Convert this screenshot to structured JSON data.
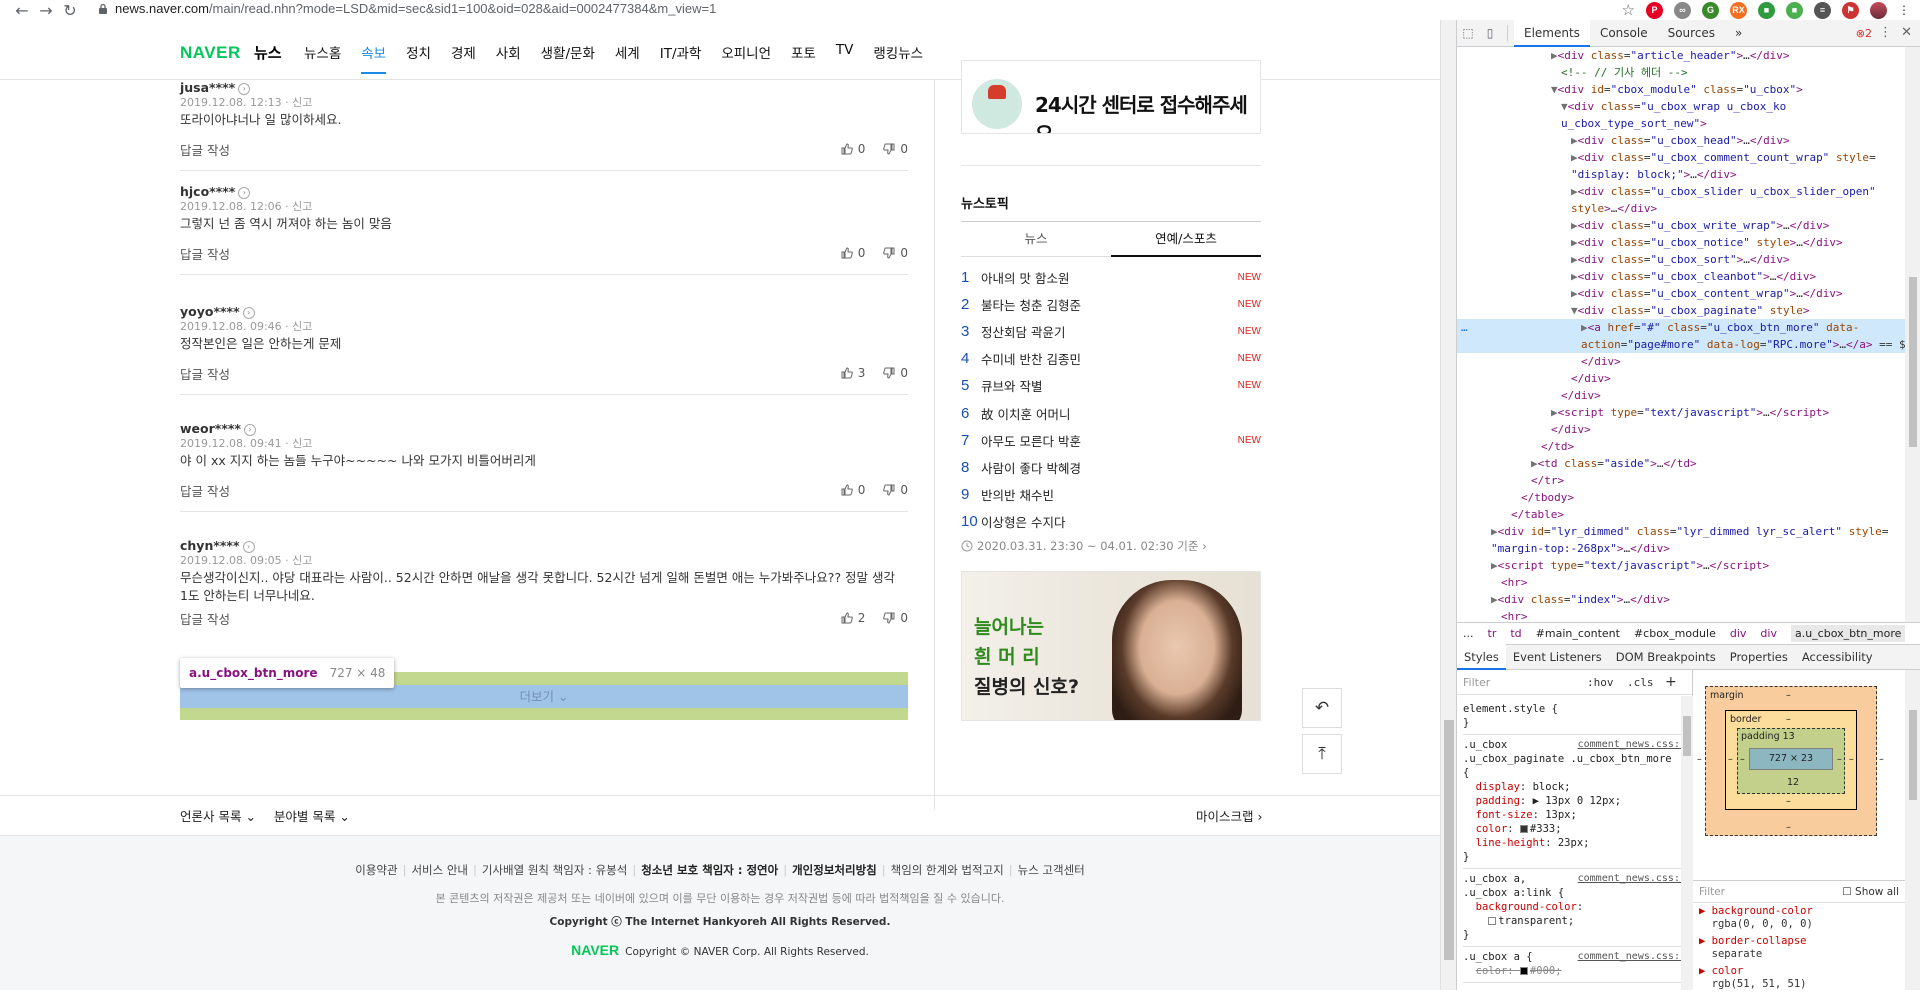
{
  "browser": {
    "url_host": "news.naver.com",
    "url_rest": "/main/read.nhn?mode=LSD&mid=sec&sid1=100&oid=028&aid=0002477384&m_view=1",
    "extensions": [
      {
        "name": "pinterest-icon",
        "color": "#e60023",
        "label": "P"
      },
      {
        "name": "ext-link-icon",
        "color": "#888888",
        "label": "∞"
      },
      {
        "name": "ext-green-icon",
        "color": "#3c8a2e",
        "label": "G"
      },
      {
        "name": "ext-rx-icon",
        "color": "#f36f20",
        "label": "RX"
      },
      {
        "name": "ext-green2-icon",
        "color": "#2e9b3e",
        "label": "■"
      },
      {
        "name": "ext-green3-icon",
        "color": "#4caf50",
        "label": "■"
      },
      {
        "name": "ext-queue-icon",
        "color": "#555555",
        "label": "≡"
      },
      {
        "name": "ext-flag-icon",
        "color": "#cc3333",
        "label": "⚑"
      }
    ]
  },
  "gnb": {
    "logo": "NAVER",
    "logo_sub": "뉴스",
    "menu": [
      "뉴스홈",
      "속보",
      "정치",
      "경제",
      "사회",
      "생활/문화",
      "세계",
      "IT/과학",
      "오피니언",
      "포토",
      "TV",
      "랭킹뉴스"
    ],
    "active_index": 1
  },
  "comments": [
    {
      "user": "jusa****",
      "date": "2019.12.08. 12:13 · 신고",
      "text": "또라이아냐너나 일 많이하세요.",
      "reply": "답글 작성",
      "up": "0",
      "down": "0"
    },
    {
      "user": "hjco****",
      "date": "2019.12.08. 12:06 · 신고",
      "text": "그렇지 넌 좀 역시 꺼져야 하는 놈이 맞음",
      "reply": "답글 작성",
      "up": "0",
      "down": "0"
    },
    {
      "user": "yoyo****",
      "date": "2019.12.08. 09:46 · 신고",
      "text": "정작본인은 일은 안하는게 문제",
      "reply": "답글 작성",
      "up": "3",
      "down": "0"
    },
    {
      "user": "weor****",
      "date": "2019.12.08. 09:41 · 신고",
      "text": "야 이 xx 지지 하는 놈들 누구야~~~~~ 나와 모가지 비틀어버리게",
      "reply": "답글 작성",
      "up": "0",
      "down": "0"
    },
    {
      "user": "chyn****",
      "date": "2019.12.08. 09:05 · 신고",
      "text": "무슨생각이신지.. 야당 대표라는 사람이.. 52시간 안하면 애날을 생각 못합니다. 52시간 넘게 일해 돈벌면 애는 누가봐주나요?? 정말 생각 1도 안하는티 너무나네요.",
      "reply": "답글 작성",
      "up": "2",
      "down": "0"
    }
  ],
  "tooltip": {
    "selector": "a.u_cbox_btn_more",
    "size": "727 × 48"
  },
  "more_button": "더보기 ⌄",
  "aside": {
    "banner_top_text": "24시간 센터로 접수해주세요",
    "topic_title": "뉴스토픽",
    "tabs": [
      "뉴스",
      "연예/스포츠"
    ],
    "active_tab": 1,
    "ranks": [
      {
        "num": "1",
        "title": "아내의 맛 함소원",
        "badge": "NEW"
      },
      {
        "num": "2",
        "title": "불타는 청춘 김형준",
        "badge": "NEW"
      },
      {
        "num": "3",
        "title": "정산회담 곽윤기",
        "badge": "NEW"
      },
      {
        "num": "4",
        "title": "수미네 반찬 김종민",
        "badge": "NEW"
      },
      {
        "num": "5",
        "title": "큐브와 작별",
        "badge": "NEW"
      },
      {
        "num": "6",
        "title": "故 이치훈 어머니",
        "badge": ""
      },
      {
        "num": "7",
        "title": "아무도 모른다 박훈",
        "badge": "NEW"
      },
      {
        "num": "8",
        "title": "사람이 좋다 박혜경",
        "badge": ""
      },
      {
        "num": "9",
        "title": "반의반 채수빈",
        "badge": ""
      },
      {
        "num": "10",
        "title": "이상형은 수지다",
        "badge": ""
      }
    ],
    "rank_time": "2020.03.31. 23:30 ~ 04.01. 02:30 기준 ›",
    "ad_lines": [
      "늘어나는",
      "흰 머 리",
      "질병의 신호?"
    ]
  },
  "float_buttons": {
    "back": "↶",
    "top": "⤒"
  },
  "footer_nav": {
    "left": [
      "언론사 목록 ⌄",
      "분야별 목록 ⌄"
    ],
    "right": "마이스크랩 ›"
  },
  "footer": {
    "links": [
      "이용약관",
      "서비스 안내",
      "기사배열 원칙 책임자 : 유봉석",
      "청소년 보호 책임자 : 정연아",
      "개인정보처리방침",
      "책임의 한계와 법적고지",
      "뉴스 고객센터"
    ],
    "bold_links": [
      3,
      4
    ],
    "note": "본 콘텐츠의 저작권은 제공처 또는 네이버에 있으며 이를 무단 이용하는 경우 저작권법 등에 따라 법적책임을 질 수 있습니다.",
    "copy1": "Copyright ⓒ The Internet Hankyoreh All Rights Reserved.",
    "copy2_logo": "NAVER",
    "copy2": "Copyright © NAVER Corp. All Rights Reserved."
  },
  "devtools": {
    "tabs": [
      "Elements",
      "Console",
      "Sources",
      "»"
    ],
    "active_tab": 0,
    "errors": "⊗2",
    "dom_lines": [
      {
        "indent": 10,
        "html": "<span class='tri'>▶</span><span class='tag'>&lt;div</span> <span class='attr'>class</span>=<span class='val'>\"article_header\"</span><span class='tag'>&gt;</span>…<span class='tag'>&lt;/div&gt;</span>"
      },
      {
        "indent": 11,
        "html": "<span class='cmt'>&lt;!-- // 기사 헤더 --&gt;</span>"
      },
      {
        "indent": 10,
        "html": "<span class='tri'>▼</span><span class='tag'>&lt;div</span> <span class='attr'>id</span>=<span class='val'>\"cbox_module\"</span> <span class='attr'>class</span>=<span class='val'>\"u_cbox\"</span><span class='tag'>&gt;</span>"
      },
      {
        "indent": 11,
        "html": "<span class='tri'>▼</span><span class='tag'>&lt;div</span> <span class='attr'>class</span>=<span class='val'>\"u_cbox_wrap u_cbox_ko</span>"
      },
      {
        "indent": 11,
        "html": "<span class='val'>u_cbox_type_sort_new\"</span><span class='tag'>&gt;</span>"
      },
      {
        "indent": 12,
        "html": "<span class='tri'>▶</span><span class='tag'>&lt;div</span> <span class='attr'>class</span>=<span class='val'>\"u_cbox_head\"</span><span class='tag'>&gt;</span>…<span class='tag'>&lt;/div&gt;</span>"
      },
      {
        "indent": 12,
        "html": "<span class='tri'>▶</span><span class='tag'>&lt;div</span> <span class='attr'>class</span>=<span class='val'>\"u_cbox_comment_count_wrap\"</span> <span class='attr'>style</span>="
      },
      {
        "indent": 12,
        "html": "<span class='val'>\"display: block;\"</span><span class='tag'>&gt;</span>…<span class='tag'>&lt;/div&gt;</span>"
      },
      {
        "indent": 12,
        "html": "<span class='tri'>▶</span><span class='tag'>&lt;div</span> <span class='attr'>class</span>=<span class='val'>\"u_cbox_slider u_cbox_slider_open\"</span>"
      },
      {
        "indent": 12,
        "html": "<span class='attr'>style</span><span class='tag'>&gt;</span>…<span class='tag'>&lt;/div&gt;</span>"
      },
      {
        "indent": 12,
        "html": "<span class='tri'>▶</span><span class='tag'>&lt;div</span> <span class='attr'>class</span>=<span class='val'>\"u_cbox_write_wrap\"</span><span class='tag'>&gt;</span>…<span class='tag'>&lt;/div&gt;</span>"
      },
      {
        "indent": 12,
        "html": "<span class='tri'>▶</span><span class='tag'>&lt;div</span> <span class='attr'>class</span>=<span class='val'>\"u_cbox_notice\"</span> <span class='attr'>style</span><span class='tag'>&gt;</span>…<span class='tag'>&lt;/div&gt;</span>"
      },
      {
        "indent": 12,
        "html": "<span class='tri'>▶</span><span class='tag'>&lt;div</span> <span class='attr'>class</span>=<span class='val'>\"u_cbox_sort\"</span><span class='tag'>&gt;</span>…<span class='tag'>&lt;/div&gt;</span>"
      },
      {
        "indent": 12,
        "html": "<span class='tri'>▶</span><span class='tag'>&lt;div</span> <span class='attr'>class</span>=<span class='val'>\"u_cbox_cleanbot\"</span><span class='tag'>&gt;</span>…<span class='tag'>&lt;/div&gt;</span>"
      },
      {
        "indent": 12,
        "html": "<span class='tri'>▶</span><span class='tag'>&lt;div</span> <span class='attr'>class</span>=<span class='val'>\"u_cbox_content_wrap\"</span><span class='tag'>&gt;</span>…<span class='tag'>&lt;/div&gt;</span>"
      },
      {
        "indent": 12,
        "html": "<span class='tri'>▼</span><span class='tag'>&lt;div</span> <span class='attr'>class</span>=<span class='val'>\"u_cbox_paginate\"</span> <span class='attr'>style</span><span class='tag'>&gt;</span>"
      },
      {
        "indent": 13,
        "html": "<span class='tri'>▶</span><span class='tag'>&lt;a</span> <span class='attr'>href</span>=<span class='val'>\"#\"</span> <span class='attr'>class</span>=<span class='val'>\"u_cbox_btn_more\"</span> <span class='attr'>data-</span>",
        "selected": true
      },
      {
        "indent": 13,
        "html": "<span class='attr'>action</span>=<span class='val'>\"page#more\"</span> <span class='attr'>data-log</span>=<span class='val'>\"RPC.more\"</span><span class='tag'>&gt;</span>…<span class='tag'>&lt;/a&gt;</span> == $0",
        "selected": true
      },
      {
        "indent": 13,
        "html": "<span class='tag'>&lt;/div&gt;</span>"
      },
      {
        "indent": 12,
        "html": "<span class='tag'>&lt;/div&gt;</span>"
      },
      {
        "indent": 11,
        "html": "<span class='tag'>&lt;/div&gt;</span>"
      },
      {
        "indent": 10,
        "html": "<span class='tri'>▶</span><span class='tag'>&lt;script</span> <span class='attr'>type</span>=<span class='val'>\"text/javascript\"</span><span class='tag'>&gt;</span>…<span class='tag'>&lt;/script&gt;</span>"
      },
      {
        "indent": 10,
        "html": "<span class='tag'>&lt;/div&gt;</span>"
      },
      {
        "indent": 9,
        "html": "<span class='tag'>&lt;/td&gt;</span>"
      },
      {
        "indent": 8,
        "html": "<span class='tri'>▶</span><span class='tag'>&lt;td</span> <span class='attr'>class</span>=<span class='val'>\"aside\"</span><span class='tag'>&gt;</span>…<span class='tag'>&lt;/td&gt;</span>"
      },
      {
        "indent": 8,
        "html": "<span class='tag'>&lt;/tr&gt;</span>"
      },
      {
        "indent": 7,
        "html": "<span class='tag'>&lt;/tbody&gt;</span>"
      },
      {
        "indent": 6,
        "html": "<span class='tag'>&lt;/table&gt;</span>"
      },
      {
        "indent": 4,
        "html": "<span class='tri'>▶</span><span class='tag'>&lt;div</span> <span class='attr'>id</span>=<span class='val'>\"lyr_dimmed\"</span> <span class='attr'>class</span>=<span class='val'>\"lyr_dimmed lyr_sc_alert\"</span> <span class='attr'>style</span>="
      },
      {
        "indent": 4,
        "html": "<span class='val'>\"margin-top:-268px\"</span><span class='tag'>&gt;</span>…<span class='tag'>&lt;/div&gt;</span>"
      },
      {
        "indent": 4,
        "html": "<span class='tri'>▶</span><span class='tag'>&lt;script</span> <span class='attr'>type</span>=<span class='val'>\"text/javascript\"</span><span class='tag'>&gt;</span>…<span class='tag'>&lt;/script&gt;</span>"
      },
      {
        "indent": 5,
        "html": "<span class='tag'>&lt;hr&gt;</span>"
      },
      {
        "indent": 4,
        "html": "<span class='tri'>▶</span><span class='tag'>&lt;div</span> <span class='attr'>class</span>=<span class='val'>\"index\"</span><span class='tag'>&gt;</span>…<span class='tag'>&lt;/div&gt;</span>"
      },
      {
        "indent": 5,
        "html": "<span class='tag'>&lt;hr&gt;</span>"
      }
    ],
    "breadcrumbs": [
      "...",
      "tr",
      "td",
      "#main_content",
      "#cbox_module",
      "div",
      "div",
      "a.u_cbox_btn_more"
    ],
    "styles_tabs": [
      "Styles",
      "Event Listeners",
      "DOM Breakpoints",
      "Properties",
      "Accessibility"
    ],
    "filter_placeholder": "Filter",
    "hov": ":hov",
    "cls": ".cls",
    "box_model": {
      "margin": "margin",
      "border": "border",
      "padding": "padding 13",
      "content": "727 × 23",
      "dash": "–",
      "pad_bottom": "12"
    },
    "computed_filter": "Filter",
    "show_all": "Show all",
    "computed": [
      {
        "name": "background-color",
        "value": "rgba(0, 0, 0, 0)"
      },
      {
        "name": "border-collapse",
        "value": "separate"
      },
      {
        "name": "color",
        "value": "rgb(51, 51, 51)"
      }
    ]
  }
}
